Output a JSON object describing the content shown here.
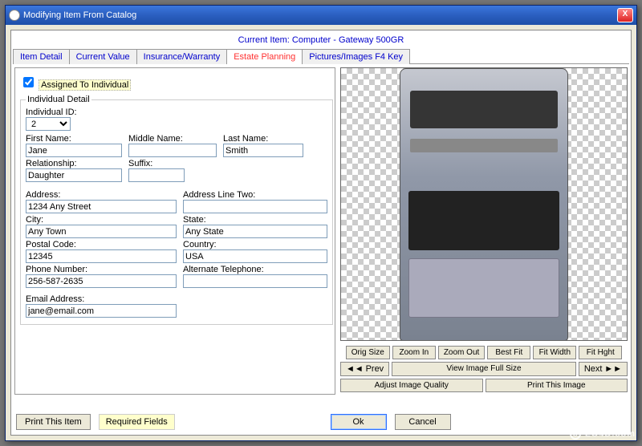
{
  "window": {
    "title": "Modifying Item From Catalog"
  },
  "header": {
    "current_item": "Current Item: Computer - Gateway 500GR"
  },
  "tabs": [
    {
      "label": "Item Detail",
      "active": false
    },
    {
      "label": "Current Value",
      "active": false
    },
    {
      "label": "Insurance/Warranty",
      "active": false
    },
    {
      "label": "Estate Planning",
      "active": true
    },
    {
      "label": "Pictures/Images  F4 Key",
      "active": false
    }
  ],
  "form": {
    "assigned_checkbox_label": "Assigned To Individual",
    "assigned_checked": true,
    "fieldset_legend": "Individual Detail",
    "individual_id": {
      "label": "Individual ID:",
      "value": "2"
    },
    "first_name": {
      "label": "First Name:",
      "value": "Jane"
    },
    "middle_name": {
      "label": "Middle Name:",
      "value": ""
    },
    "last_name": {
      "label": "Last Name:",
      "value": "Smith"
    },
    "relationship": {
      "label": "Relationship:",
      "value": "Daughter"
    },
    "suffix": {
      "label": "Suffix:",
      "value": ""
    },
    "address": {
      "label": "Address:",
      "value": "1234 Any Street"
    },
    "address2": {
      "label": "Address Line Two:",
      "value": ""
    },
    "city": {
      "label": "City:",
      "value": "Any Town"
    },
    "state": {
      "label": "State:",
      "value": "Any State"
    },
    "postal": {
      "label": "Postal Code:",
      "value": "12345"
    },
    "country": {
      "label": "Country:",
      "value": "USA"
    },
    "phone": {
      "label": "Phone Number:",
      "value": "256-587-2635"
    },
    "alt_phone": {
      "label": "Alternate Telephone:",
      "value": ""
    },
    "email": {
      "label": "Email Address:",
      "value": "jane@email.com"
    }
  },
  "image_buttons": {
    "orig_size": "Orig Size",
    "zoom_in": "Zoom In",
    "zoom_out": "Zoom Out",
    "best_fit": "Best Fit",
    "fit_width": "Fit Width",
    "fit_height": "Fit Hght",
    "prev": "Prev",
    "view_full": "View Image Full Size",
    "next": "Next",
    "adjust": "Adjust Image Quality",
    "print_image": "Print This Image"
  },
  "footer": {
    "print_item": "Print This Item",
    "required_fields": "Required Fields",
    "ok": "Ok",
    "cancel": "Cancel"
  },
  "icons": {
    "prev_glyph": "◄◄",
    "next_glyph": "►►"
  },
  "watermark": "LO4D.com"
}
